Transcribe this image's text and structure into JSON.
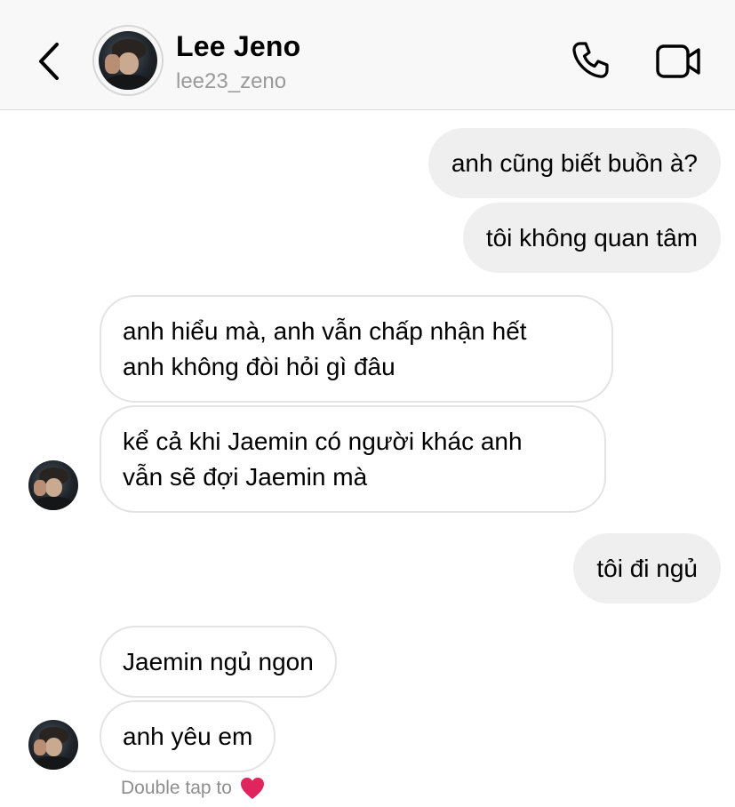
{
  "header": {
    "name": "Lee Jeno",
    "username": "lee23_zeno",
    "back_icon": "chevron-left-icon",
    "call_icon": "phone-icon",
    "video_icon": "video-camera-icon"
  },
  "messages": [
    {
      "from": "me",
      "lines": [
        "anh cũng biết buồn à?"
      ]
    },
    {
      "from": "me",
      "lines": [
        "tôi không quan tâm"
      ]
    },
    {
      "from": "them",
      "lines": [
        "anh hiểu mà, anh vẫn chấp nhận hết",
        "anh không đòi hỏi gì đâu"
      ]
    },
    {
      "from": "them",
      "lines": [
        "kể cả khi Jaemin có người khác anh",
        "vẫn sẽ đợi Jaemin mà"
      ]
    },
    {
      "from": "me",
      "lines": [
        "tôi đi ngủ"
      ]
    },
    {
      "from": "them",
      "lines": [
        "Jaemin ngủ ngon"
      ]
    },
    {
      "from": "them",
      "lines": [
        "anh yêu em"
      ]
    }
  ],
  "hint": {
    "text": "Double tap to",
    "icon": "heart-icon",
    "heart_color": "#e0245e"
  },
  "colors": {
    "outgoing_bubble": "#efefef",
    "incoming_border": "#e3e3e3",
    "header_bg": "#f8f8f8",
    "muted_text": "#9a9a9a"
  }
}
